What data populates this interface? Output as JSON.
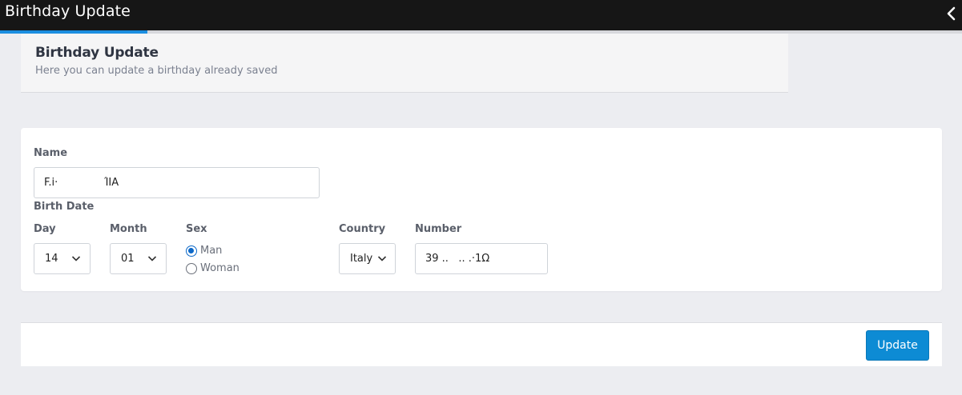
{
  "topbar": {
    "title": "Birthday Update",
    "progress_fraction": 0.153
  },
  "header": {
    "title": "Birthday Update",
    "subtitle": "Here you can update a birthday already saved"
  },
  "form": {
    "name_label": "Name",
    "name_value": "F.i·              ΊIA",
    "birth_date_label": "Birth Date",
    "day_label": "Day",
    "day_value": "14",
    "month_label": "Month",
    "month_value": "01",
    "sex_label": "Sex",
    "sex_options": [
      "Man",
      "Woman"
    ],
    "sex_selected": "Man",
    "country_label": "Country",
    "country_value": "Italy",
    "number_label": "Number",
    "number_value": "39 ..   .. .·1Ω"
  },
  "footer": {
    "update_label": "Update"
  },
  "colors": {
    "topbar": "#161616",
    "accent": "#1b8ee0",
    "button": "#0d8bd4",
    "radio_selected": "#0c68c8",
    "page_bg": "#ecedf1"
  }
}
